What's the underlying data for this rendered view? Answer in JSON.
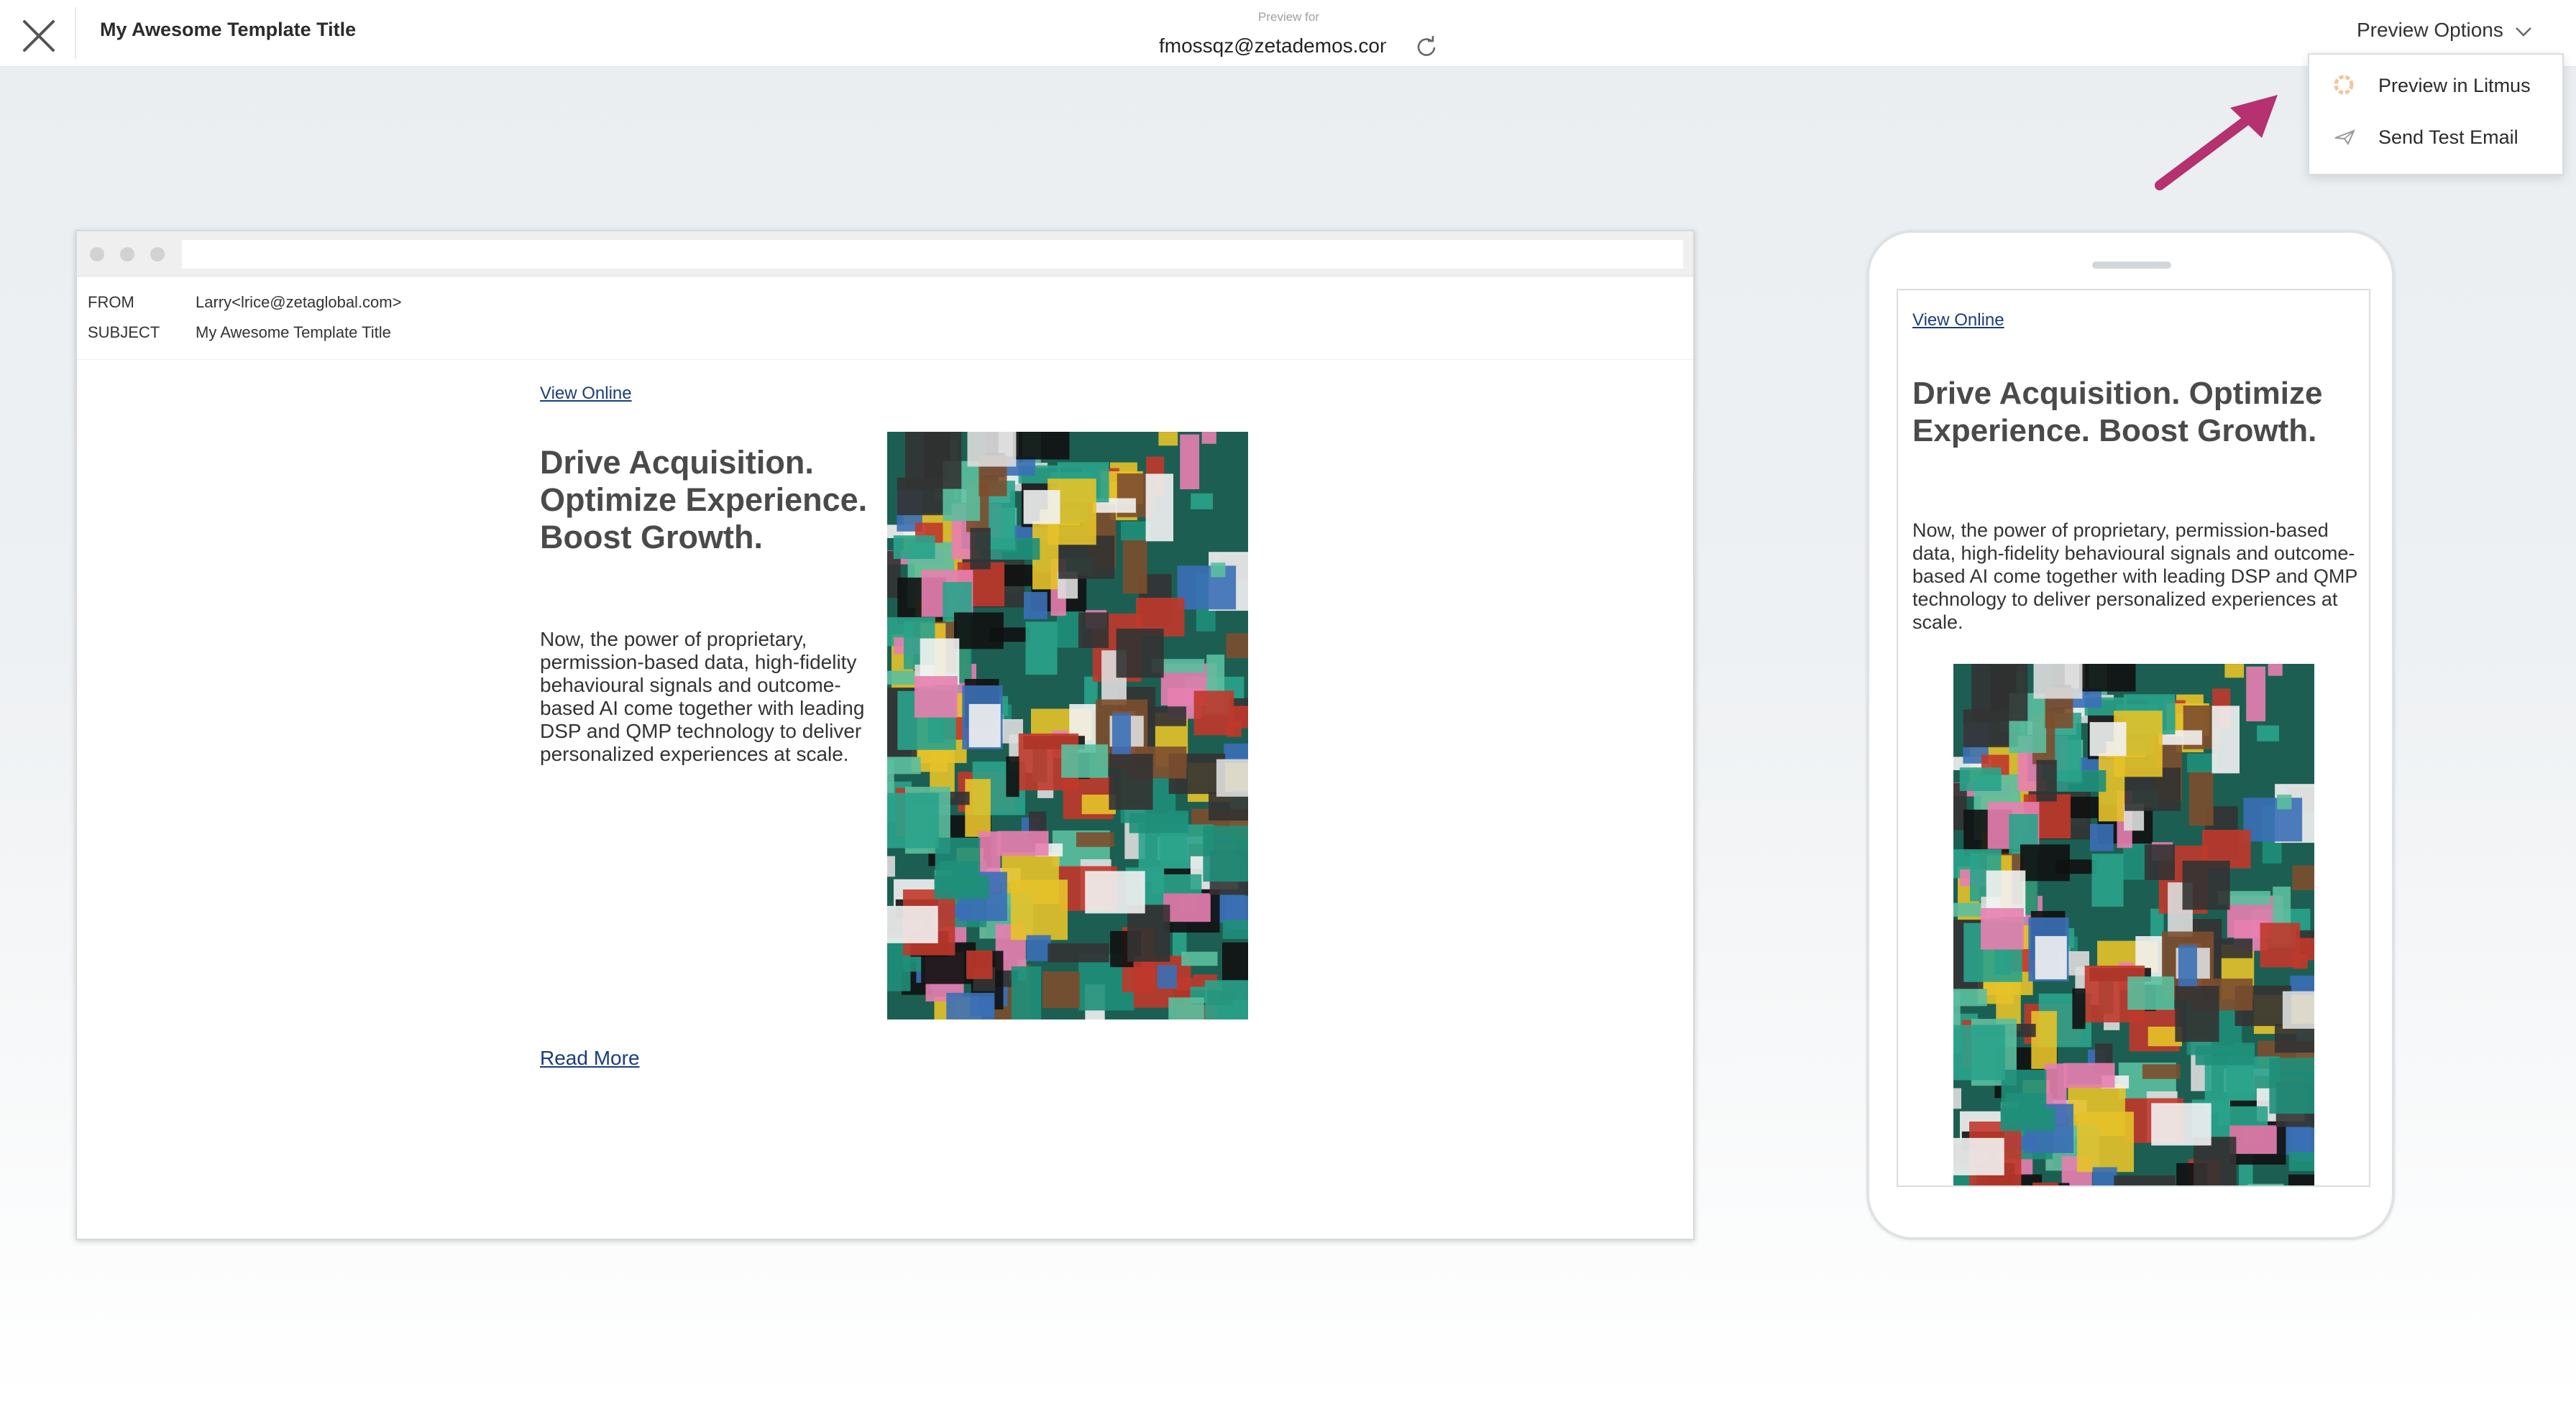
{
  "header": {
    "template_title": "My Awesome Template Title",
    "preview_for_label": "Preview for",
    "preview_email": "fmossqz@zetademos.com",
    "preview_options_label": "Preview Options"
  },
  "preview_menu": {
    "items": [
      {
        "label": "Preview in Litmus",
        "icon": "litmus-icon"
      },
      {
        "label": "Send Test Email",
        "icon": "paper-plane-icon"
      }
    ]
  },
  "email": {
    "from_label": "FROM",
    "from_value": "Larry<lrice@zetaglobal.com>",
    "subject_label": "SUBJECT",
    "subject_value": "My Awesome Template Title",
    "view_online": "View Online",
    "headline": "Drive Acquisition. Optimize Experience. Boost Growth.",
    "body": "Now, the power of proprietary, permission-based data, high-fidelity behavioural signals and outcome-based AI come together with leading DSP and QMP technology to deliver personalized experiences at scale.",
    "read_more": "Read More",
    "image": "sticker-collage-photo"
  },
  "colors": {
    "link": "#1a3d7c",
    "accent_arrow": "#b5316f",
    "headline": "#4a4a4a"
  }
}
